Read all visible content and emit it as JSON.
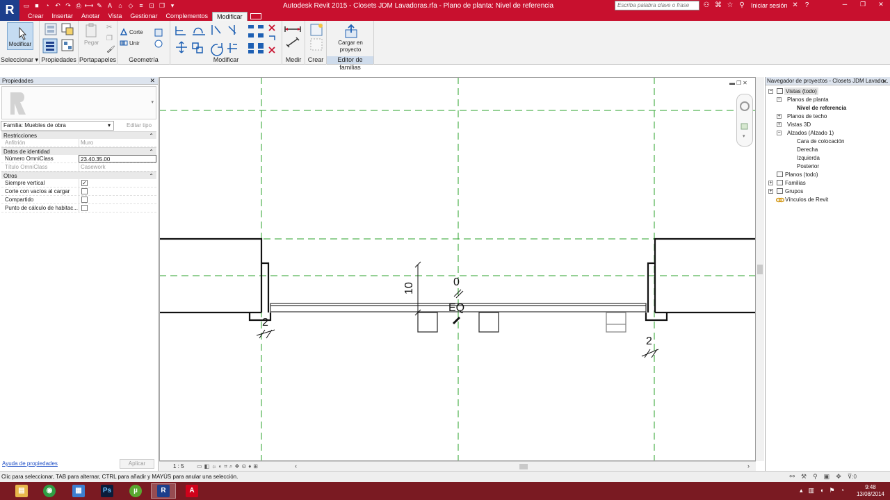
{
  "title": "Autodesk Revit 2015  -    Closets JDM Lavadoras.rfa - Plano de planta: Nivel de referencia",
  "search_placeholder": "Escriba palabra clave o frase",
  "signin": "Iniciar sesión",
  "tabs": [
    "Crear",
    "Insertar",
    "Anotar",
    "Vista",
    "Gestionar",
    "Complementos",
    "Modificar"
  ],
  "ribbon": {
    "modify_label": "Modificar",
    "corte": "Corte",
    "unir": "Unir",
    "pegar": "Pegar",
    "cargar_line1": "Cargar en",
    "cargar_line2": "proyecto",
    "panels": [
      "Seleccionar ▾",
      "Propiedades",
      "Portapapeles",
      "Geometría",
      "Modificar",
      "Medir",
      "Crear",
      "Editor de familias"
    ]
  },
  "properties": {
    "header": "Propiedades",
    "family": "Familia: Muebles de obra",
    "edit_type": "Editar tipo",
    "groups": {
      "restricciones": "Restricciones",
      "identidad": "Datos de identidad",
      "otros": "Otros"
    },
    "rows": {
      "anfitrion_k": "Anfitrión",
      "anfitrion_v": "Muro",
      "omni_num_k": "Número OmniClass",
      "omni_num_v": "23.40.35.00",
      "omni_tit_k": "Título OmniClass",
      "omni_tit_v": "Casework",
      "siempre_k": "Siempre vertical",
      "corte_k": "Corte con vacíos al cargar",
      "compartido_k": "Compartido",
      "punto_k": "Punto de cálculo de habitac..."
    },
    "checks": {
      "siempre": true,
      "corte": false,
      "compartido": false,
      "punto": false
    },
    "help": "Ayuda de propiedades",
    "apply": "Aplicar"
  },
  "canvas": {
    "scale": "1 : 5",
    "dims": {
      "left_gap": "2",
      "right_gap": "2",
      "height": "10",
      "offset": "0",
      "eq": "EQ"
    }
  },
  "browser": {
    "header": "Navegador de proyectos - Closets JDM Lavado...",
    "nodes": {
      "vistas": "Vistas (todo)",
      "planos_planta": "Planos de planta",
      "nivel_ref": "Nivel de referencia",
      "planos_techo": "Planos de techo",
      "vistas3d": "Vistas 3D",
      "alzados": "Alzados (Alzado 1)",
      "cara": "Cara de colocación",
      "derecha": "Derecha",
      "izquierda": "Izquierda",
      "posterior": "Posterior",
      "planos_todo": "Planos (todo)",
      "familias": "Familias",
      "grupos": "Grupos",
      "vinculos": "Vínculos de Revit"
    }
  },
  "status": "Clic para seleccionar, TAB para alternar, CTRL para añadir y MAYÚS para anular una selección.",
  "filter_count": ":0",
  "clock": {
    "time": "9:48",
    "date": "13/08/2014"
  },
  "colors": {
    "title_red": "#c8102e",
    "ref_plane_green": "#2aa02a",
    "taskbar": "#7a1a22"
  }
}
